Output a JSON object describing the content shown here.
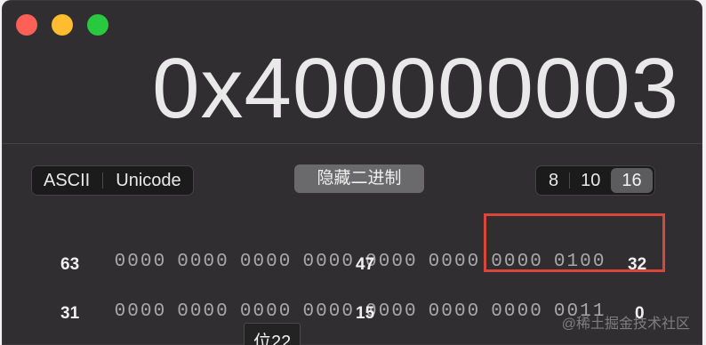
{
  "window": {
    "buttons": {
      "close": "close",
      "minimize": "minimize",
      "maximize": "maximize"
    }
  },
  "display": {
    "value": "0x400000003"
  },
  "encoding": {
    "options": [
      "ASCII",
      "Unicode"
    ]
  },
  "hide_binary_label": "隐藏二进制",
  "base": {
    "options": [
      "8",
      "10",
      "16"
    ],
    "selected": "16"
  },
  "bits": {
    "row1": {
      "nibbles": [
        "0000",
        "0000",
        "0000",
        "0000",
        "0000",
        "0000",
        "0000",
        "0100"
      ],
      "labels": {
        "left": "63",
        "mid": "47",
        "right": "32"
      }
    },
    "row2": {
      "nibbles": [
        "0000",
        "0000",
        "0000",
        "0000",
        "0000",
        "0000",
        "0000",
        "0011"
      ],
      "labels": {
        "left": "31",
        "mid": "15",
        "right": "0"
      }
    }
  },
  "tooltip": "位22",
  "watermark": "@稀土掘金技术社区",
  "colors": {
    "window_bg": "#302e30",
    "highlight_border": "#d9463a",
    "active_segment": "#5c5b5d"
  }
}
